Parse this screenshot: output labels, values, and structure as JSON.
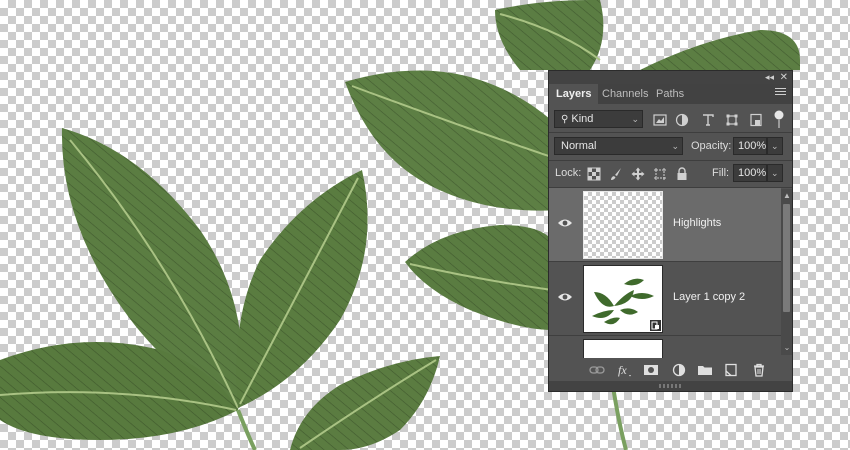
{
  "panel": {
    "tabs": [
      {
        "label": "Layers",
        "active": true
      },
      {
        "label": "Channels",
        "active": false
      },
      {
        "label": "Paths",
        "active": false
      }
    ],
    "filter": {
      "label": "Kind"
    },
    "blend_mode": {
      "value": "Normal"
    },
    "opacity": {
      "label": "Opacity:",
      "value": "100%"
    },
    "lock": {
      "label": "Lock:"
    },
    "fill": {
      "label": "Fill:",
      "value": "100%"
    },
    "layers": [
      {
        "name": "Highlights",
        "selected": true,
        "visible": true
      },
      {
        "name": "Layer 1 copy 2",
        "selected": false,
        "visible": true,
        "smart_object": true
      }
    ],
    "bottom_icons": [
      "link-icon",
      "fx-icon",
      "mask-icon",
      "adjustment-icon",
      "folder-icon",
      "new-layer-icon",
      "trash-icon"
    ]
  },
  "colors": {
    "panel_bg": "#535353",
    "tab_bar": "#424242",
    "selected_layer": "#6b6b6b",
    "leaf_green": "#5a7a40",
    "leaf_vein": "#a8c080"
  }
}
